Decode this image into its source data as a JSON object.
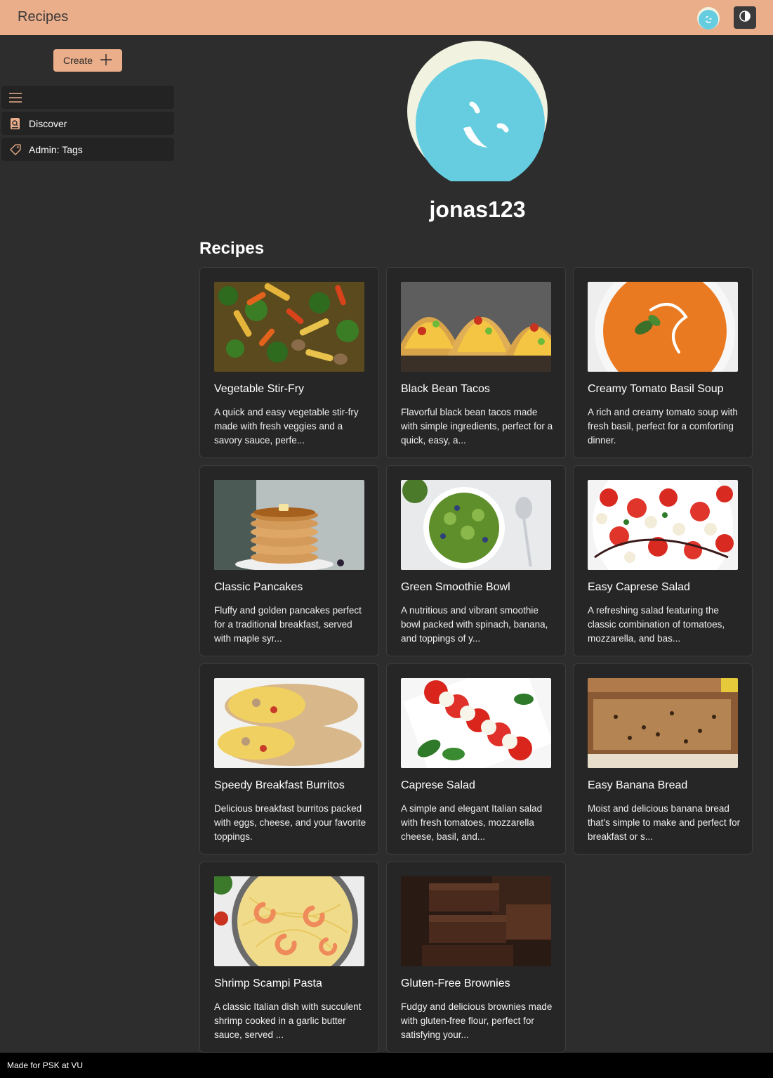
{
  "header": {
    "title": "Recipes",
    "avatar_icon": "smiley-avatar-icon",
    "theme_icon": "contrast-icon"
  },
  "sidebar": {
    "create_label": "Create",
    "items": [
      {
        "label": "",
        "icon": "hamburger-icon"
      },
      {
        "label": "Discover",
        "icon": "search-book-icon"
      },
      {
        "label": "Admin: Tags",
        "icon": "tag-icon"
      }
    ]
  },
  "profile": {
    "username": "jonas123"
  },
  "recipes_section": {
    "title": "Recipes",
    "cards": [
      {
        "title": "Vegetable Stir-Fry",
        "description": "A quick and easy vegetable stir-fry made with fresh veggies and a savory sauce, perfe..."
      },
      {
        "title": "Black Bean Tacos",
        "description": "Flavorful black bean tacos made with simple ingredients, perfect for a quick, easy, a..."
      },
      {
        "title": "Creamy Tomato Basil Soup",
        "description": "A rich and creamy tomato soup with fresh basil, perfect for a comforting dinner."
      },
      {
        "title": "Classic Pancakes",
        "description": "Fluffy and golden pancakes perfect for a traditional breakfast, served with maple syr..."
      },
      {
        "title": "Green Smoothie Bowl",
        "description": "A nutritious and vibrant smoothie bowl packed with spinach, banana, and toppings of y..."
      },
      {
        "title": "Easy Caprese Salad",
        "description": "A refreshing salad featuring the classic combination of tomatoes, mozzarella, and bas..."
      },
      {
        "title": "Speedy Breakfast Burritos",
        "description": "Delicious breakfast burritos packed with eggs, cheese, and your favorite toppings."
      },
      {
        "title": "Caprese Salad",
        "description": "A simple and elegant Italian salad with fresh tomatoes, mozzarella cheese, basil, and..."
      },
      {
        "title": "Easy Banana Bread",
        "description": "Moist and delicious banana bread that's simple to make and perfect for breakfast or s..."
      },
      {
        "title": "Shrimp Scampi Pasta",
        "description": "A classic Italian dish with succulent shrimp cooked in a garlic butter sauce, served ..."
      },
      {
        "title": "Gluten-Free Brownies",
        "description": "Fudgy and delicious brownies made with gluten-free flour, perfect for satisfying your..."
      }
    ]
  },
  "footer": {
    "text": "Made for PSK at VU"
  },
  "colors": {
    "accent": "#ebae8a",
    "background": "#2d2d2d",
    "card": "#262626",
    "avatar_blue": "#66cde0",
    "avatar_cream": "#f1f2e0"
  }
}
